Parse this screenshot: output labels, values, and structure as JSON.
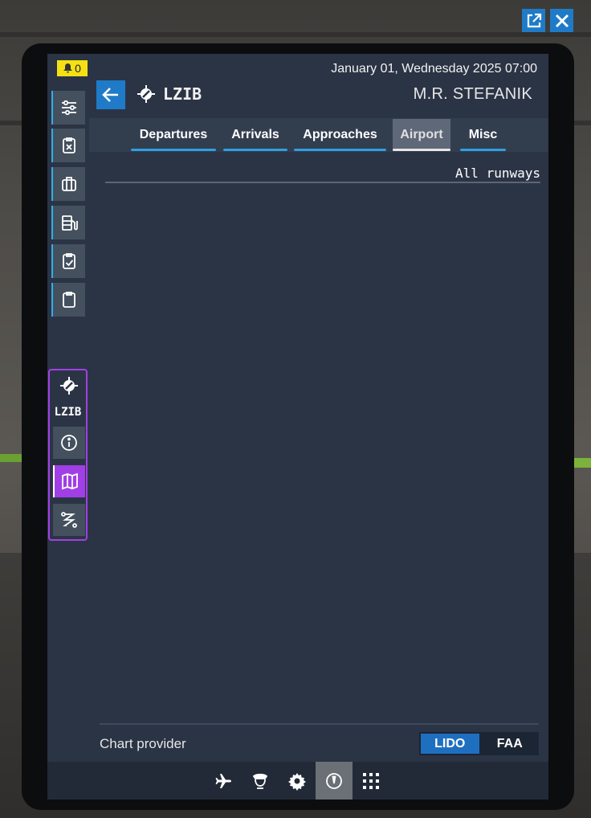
{
  "window_controls": {
    "popout_icon": "external-link-icon",
    "close_icon": "close-icon"
  },
  "notifications": {
    "count": "0",
    "icon": "bell-icon"
  },
  "header": {
    "datetime": "January 01, Wednesday 2025 07:00",
    "icao": "LZIB",
    "airport_name": "M.R. STEFANIK"
  },
  "sidebar": {
    "items": [
      {
        "name": "sliders-icon"
      },
      {
        "name": "clipboard-x-icon"
      },
      {
        "name": "briefcase-icon"
      },
      {
        "name": "fuel-icon"
      },
      {
        "name": "clipboard-check-icon"
      },
      {
        "name": "clipboard-icon"
      }
    ],
    "airport_group": {
      "label": "LZIB",
      "items": [
        {
          "name": "info-icon"
        },
        {
          "name": "map-icon"
        },
        {
          "name": "route-icon"
        }
      ]
    }
  },
  "tabs": [
    {
      "label": "Departures"
    },
    {
      "label": "Arrivals"
    },
    {
      "label": "Approaches"
    },
    {
      "label": "Airport",
      "active": true
    },
    {
      "label": "Misc"
    }
  ],
  "filter": {
    "label": "All runways"
  },
  "chart_provider": {
    "label": "Chart provider",
    "options": [
      "LIDO",
      "FAA"
    ],
    "selected": "LIDO"
  },
  "bottom_bar": {
    "items": [
      "plane-icon",
      "pilot-icon",
      "gear-icon",
      "compass-icon",
      "apps-grid-icon"
    ],
    "active": "compass-icon"
  },
  "colors": {
    "accent": "#1f7bc8",
    "tab_underline": "#2f9fe2",
    "airport_group": "#a13fe6",
    "notification": "#f5e014",
    "screen_bg": "#2b3445"
  }
}
